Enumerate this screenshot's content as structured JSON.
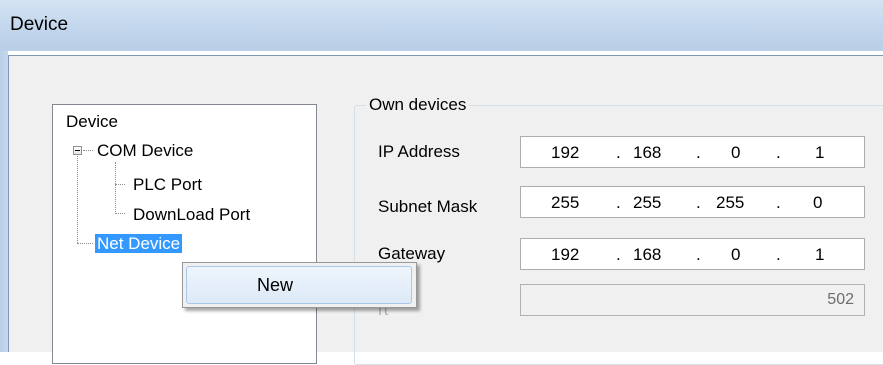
{
  "window": {
    "title": "Device"
  },
  "tree": {
    "root": "Device",
    "com_device": "COM Device",
    "plc_port": "PLC Port",
    "download_port": "DownLoad Port",
    "net_device": "Net Device"
  },
  "own_devices": {
    "legend": "Own devices",
    "ip_address": {
      "label": "IP Address",
      "octets": [
        "192",
        "168",
        "0",
        "1"
      ]
    },
    "subnet_mask": {
      "label": "Subnet Mask",
      "octets": [
        "255",
        "255",
        "255",
        "0"
      ]
    },
    "gateway": {
      "label": "Gateway",
      "octets": [
        "192",
        "168",
        "0",
        "1"
      ]
    },
    "port": {
      "label_visible": "rt",
      "value": "502"
    }
  },
  "context_menu": {
    "items": [
      {
        "label": "New"
      }
    ]
  }
}
